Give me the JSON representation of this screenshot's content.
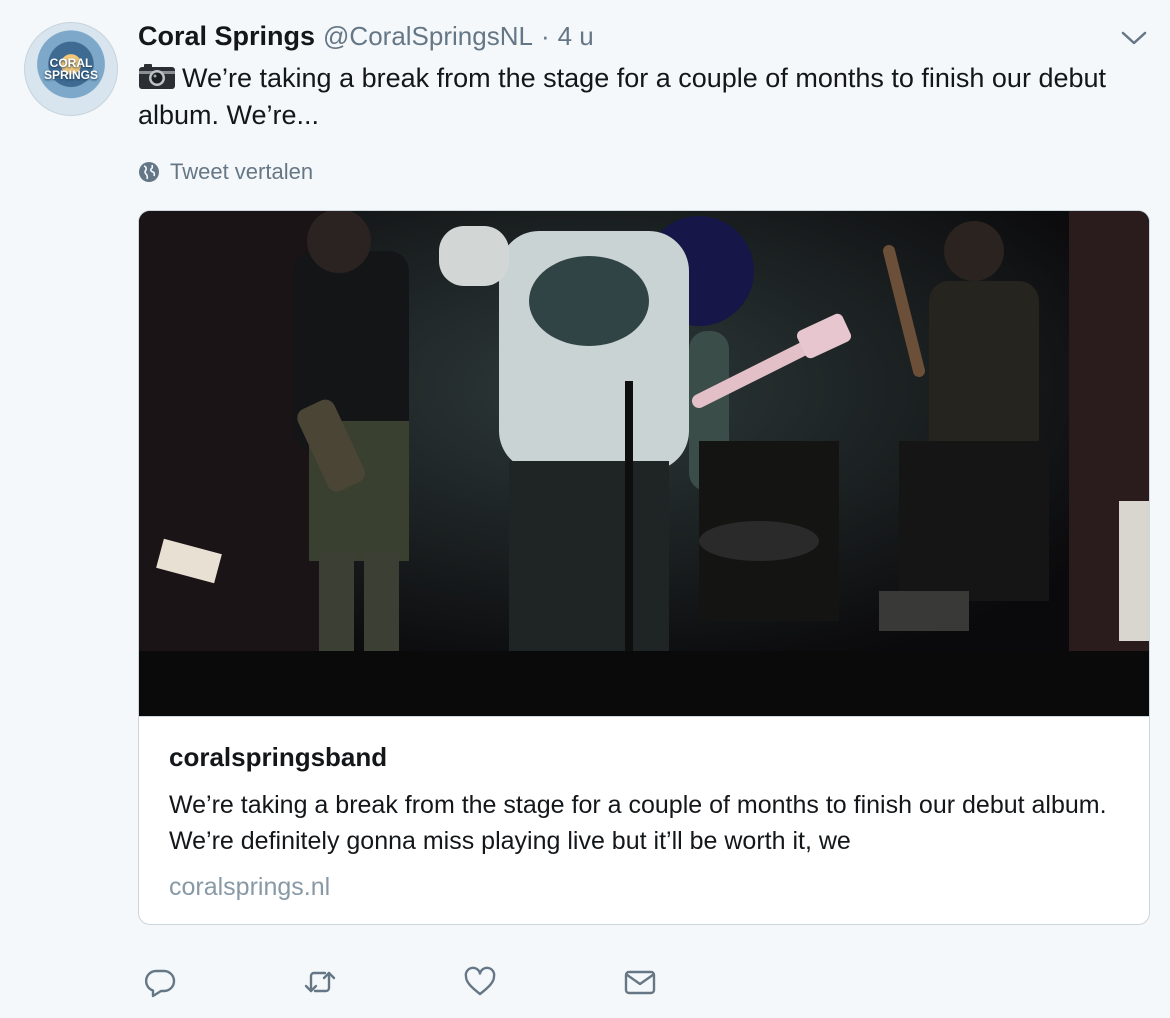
{
  "tweet": {
    "author_name": "Coral Springs",
    "handle": "@CoralSpringsNL",
    "separator": "·",
    "time": "4 u",
    "text": "We’re taking a break from the stage for a couple of months to finish our debut album. We’re...",
    "translate_label": "Tweet vertalen"
  },
  "avatar": {
    "logo_text": "CORAL SPRINGS"
  },
  "card": {
    "title": "coralspringsband",
    "description": "We’re taking a break from the stage for a couple of months to finish our debut album. We’re definitely gonna miss playing live but it’ll be worth it, we",
    "domain": "coralsprings.nl"
  },
  "icons": {
    "caret": "chevron-down-icon",
    "camera": "camera-icon",
    "globe": "globe-icon",
    "reply": "reply-icon",
    "retweet": "retweet-icon",
    "like": "heart-icon",
    "message": "envelope-icon"
  },
  "colors": {
    "background": "#f5f8fa",
    "text": "#14171a",
    "secondary": "#657786",
    "border": "#ccd6dd"
  }
}
